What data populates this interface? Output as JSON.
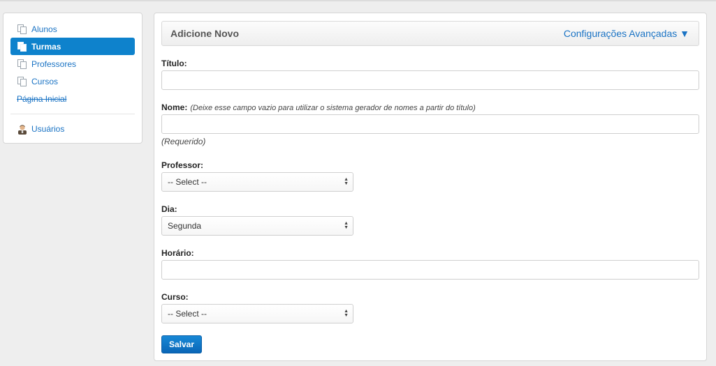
{
  "sidebar": {
    "items": [
      {
        "label": "Alunos",
        "icon": "document-icon"
      },
      {
        "label": "Turmas",
        "icon": "document-icon",
        "active": true
      },
      {
        "label": "Professores",
        "icon": "document-icon"
      },
      {
        "label": "Cursos",
        "icon": "document-icon"
      },
      {
        "label": "Página Inicial",
        "icon": "none"
      }
    ],
    "users": {
      "label": "Usuários",
      "icon": "user-icon"
    }
  },
  "panel": {
    "title": "Adicione Novo",
    "advanced_link": "Configurações Avançadas ▼"
  },
  "form": {
    "titulo_label": "Título:",
    "titulo_value": "",
    "nome_label": "Nome:",
    "nome_hint": "(Deixe esse campo vazio para utilizar o sistema gerador de nomes a partir do título)",
    "nome_value": "",
    "nome_required": "(Requerido)",
    "professor_label": "Professor:",
    "professor_value": "-- Select --",
    "dia_label": "Dia:",
    "dia_value": "Segunda",
    "horario_label": "Horário:",
    "horario_value": "",
    "curso_label": "Curso:",
    "curso_value": "-- Select --",
    "save_label": "Salvar"
  },
  "colors": {
    "accent": "#0e82cc",
    "link": "#1a73c4"
  }
}
